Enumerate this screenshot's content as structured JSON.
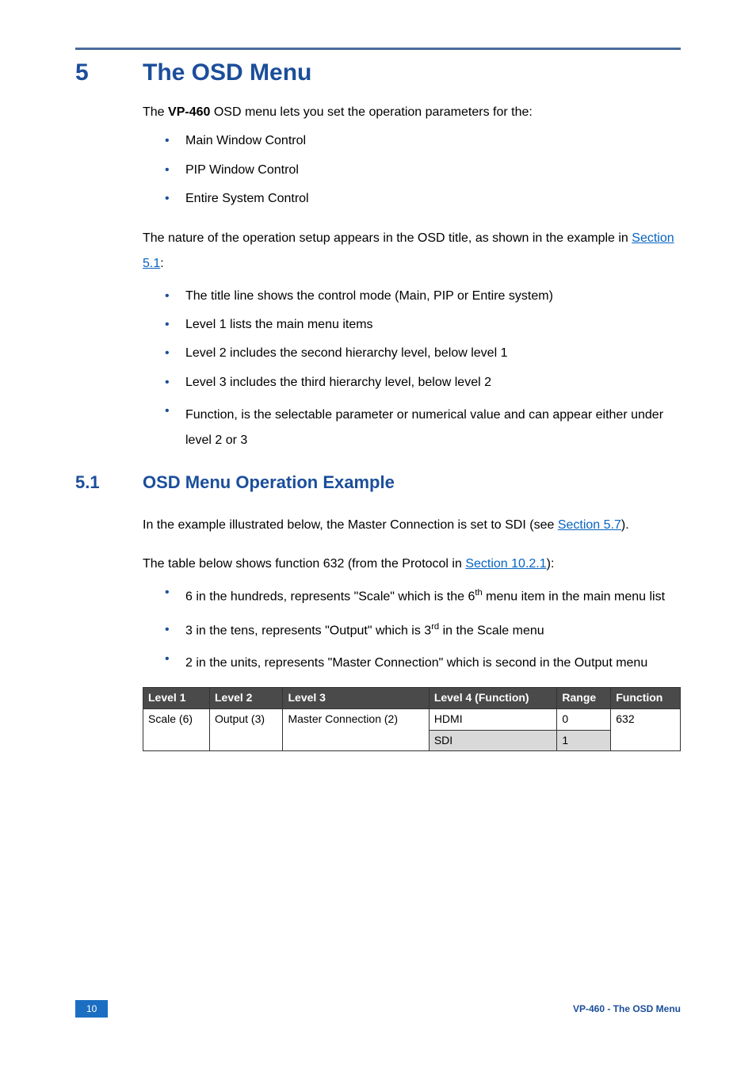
{
  "header": {
    "section_number": "5",
    "section_title": "The OSD Menu"
  },
  "intro_prefix": "The ",
  "intro_bold": "VP-460",
  "intro_suffix": " OSD menu lets you set the operation parameters for the:",
  "intro_bullets": [
    "Main Window Control",
    "PIP Window Control",
    "Entire System Control"
  ],
  "nature_prefix": "The nature of the operation setup appears in the OSD title, as shown in the example in ",
  "nature_link": "Section 5.1",
  "nature_suffix": ":",
  "nature_bullets": [
    "The title line shows the control mode (Main, PIP or Entire system)",
    "Level 1 lists the main menu items",
    "Level 2 includes the second hierarchy level, below level 1",
    "Level 3 includes the third hierarchy level, below level 2",
    "Function, is the selectable parameter or numerical value and can appear either under level 2 or 3"
  ],
  "subheader": {
    "sub_number": "5.1",
    "sub_title": "OSD Menu Operation Example"
  },
  "example_prefix": "In the example illustrated below, the Master Connection is set to SDI (see ",
  "example_link": "Section 5.7",
  "example_suffix": ").",
  "table_intro_prefix": "The table below shows function 632 (from the Protocol in ",
  "table_intro_link": "Section 10.2.1",
  "table_intro_suffix": "):",
  "fn_bullets": {
    "b1_pre": "6 in the hundreds, represents \"Scale\" which is the 6",
    "b1_sup": "th",
    "b1_post": " menu item in the main menu list",
    "b2_pre": "3 in the tens, represents \"Output\" which is 3",
    "b2_sup": "rd",
    "b2_post": " in the Scale menu",
    "b3": "2 in the units, represents \"Master Connection\" which is second in the Output menu"
  },
  "table": {
    "headers": {
      "c1": "Level 1",
      "c2": "Level 2",
      "c3": "Level 3",
      "c4": "Level 4 (Function)",
      "c5": "Range",
      "c6": "Function"
    },
    "r1": {
      "c1": "Scale (6)",
      "c2": "Output (3)",
      "c3": "Master Connection (2)",
      "c4": "HDMI",
      "c5": "0",
      "c6": "632"
    },
    "r2": {
      "c4": "SDI",
      "c5": "1"
    }
  },
  "footer": {
    "page_number": "10",
    "right_text": "VP-460 - The OSD Menu"
  }
}
